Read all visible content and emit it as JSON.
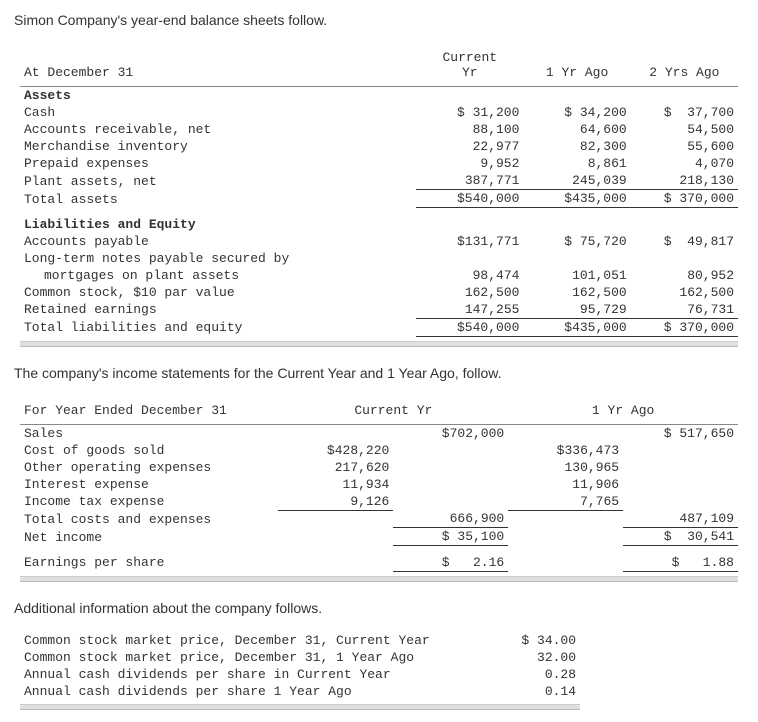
{
  "intro1": "Simon Company's year-end balance sheets follow.",
  "bs": {
    "header": {
      "c0": "At December 31",
      "c1a": "Current",
      "c1b": "Yr",
      "c2": "1 Yr Ago",
      "c3": "2 Yrs Ago"
    },
    "assets_hdr": "Assets",
    "rows": {
      "cash": {
        "l": "Cash",
        "c": "$ 31,200",
        "y1": "$ 34,200",
        "y2": "$  37,700"
      },
      "ar": {
        "l": "Accounts receivable, net",
        "c": "88,100",
        "y1": "64,600",
        "y2": "54,500"
      },
      "inv": {
        "l": "Merchandise inventory",
        "c": "22,977",
        "y1": "82,300",
        "y2": "55,600"
      },
      "prepaid": {
        "l": "Prepaid expenses",
        "c": "9,952",
        "y1": "8,861",
        "y2": "4,070"
      },
      "plant": {
        "l": "Plant assets, net",
        "c": "387,771",
        "y1": "245,039",
        "y2": "218,130"
      },
      "tassets": {
        "l": "Total assets",
        "c": "$540,000",
        "y1": "$435,000",
        "y2": "$ 370,000"
      }
    },
    "liab_hdr": "Liabilities and Equity",
    "lrows": {
      "ap": {
        "l": "Accounts payable",
        "c": "$131,771",
        "y1": "$ 75,720",
        "y2": "$  49,817"
      },
      "ltn1": {
        "l": "Long-term notes payable secured by"
      },
      "ltn2": {
        "l": "mortgages on plant assets",
        "c": "98,474",
        "y1": "101,051",
        "y2": "80,952"
      },
      "cs": {
        "l": "Common stock, $10 par value",
        "c": "162,500",
        "y1": "162,500",
        "y2": "162,500"
      },
      "re": {
        "l": "Retained earnings",
        "c": "147,255",
        "y1": "95,729",
        "y2": "76,731"
      },
      "tle": {
        "l": "Total liabilities and equity",
        "c": "$540,000",
        "y1": "$435,000",
        "y2": "$ 370,000"
      }
    }
  },
  "intro2": "The company's income statements for the Current Year and 1 Year Ago, follow.",
  "is": {
    "header": {
      "c0": "For Year Ended December 31",
      "cy": "Current Yr",
      "py": "1 Yr Ago"
    },
    "rows": {
      "sales": {
        "l": "Sales",
        "ct": "$702,000",
        "pt": "$ 517,650"
      },
      "cogs": {
        "l": "Cost of goods sold",
        "cd": "$428,220",
        "pd": "$336,473"
      },
      "oop": {
        "l": "Other operating expenses",
        "cd": "217,620",
        "pd": "130,965"
      },
      "int": {
        "l": "Interest expense",
        "cd": "11,934",
        "pd": "11,906"
      },
      "tax": {
        "l": "Income tax expense",
        "cd": "9,126",
        "pd": "7,765"
      },
      "tcost": {
        "l": "Total costs and expenses",
        "ct": "666,900",
        "pt": "487,109"
      },
      "ni": {
        "l": "Net income",
        "ct": "$ 35,100",
        "pt": "$  30,541"
      },
      "eps": {
        "l": "Earnings per share",
        "ct": "$   2.16",
        "pt": "$   1.88"
      }
    }
  },
  "intro3": "Additional information about the company follows.",
  "add": {
    "r1": {
      "l": "Common stock market price, December 31, Current Year",
      "v": "$ 34.00"
    },
    "r2": {
      "l": "Common stock market price, December 31, 1 Year Ago",
      "v": "32.00"
    },
    "r3": {
      "l": "Annual cash dividends per share in Current Year",
      "v": "0.28"
    },
    "r4": {
      "l": "Annual cash dividends per share 1 Year Ago",
      "v": "0.14"
    }
  }
}
